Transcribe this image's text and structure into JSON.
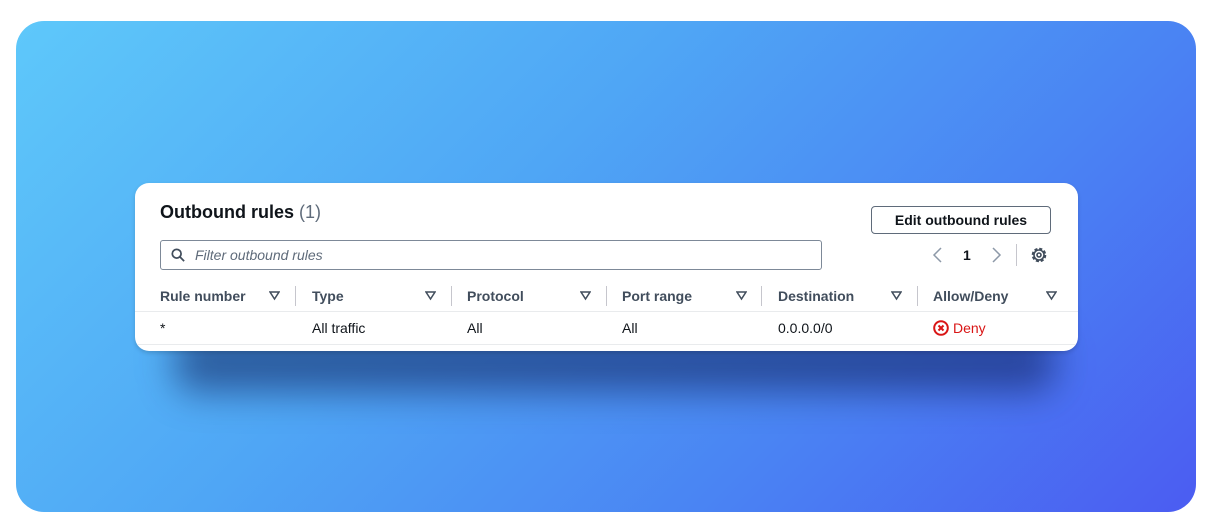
{
  "panel": {
    "title": "Outbound rules",
    "count": "(1)",
    "edit_button": "Edit outbound rules",
    "filter_placeholder": "Filter outbound rules",
    "page": "1"
  },
  "table": {
    "columns": [
      "Rule number",
      "Type",
      "Protocol",
      "Port range",
      "Destination",
      "Allow/Deny"
    ],
    "rows": [
      {
        "rule_number": "*",
        "type": "All traffic",
        "protocol": "All",
        "port_range": "All",
        "destination": "0.0.0.0/0",
        "action": "Deny"
      }
    ]
  },
  "colors": {
    "deny": "#d91515",
    "text": "#0f141a",
    "header_text": "#414d5c"
  },
  "icons": {
    "search": "search-icon",
    "prev": "chevron-left-icon",
    "next": "chevron-right-icon",
    "settings": "gear-icon",
    "sort": "sort-down-icon",
    "deny": "x-circle-icon"
  }
}
